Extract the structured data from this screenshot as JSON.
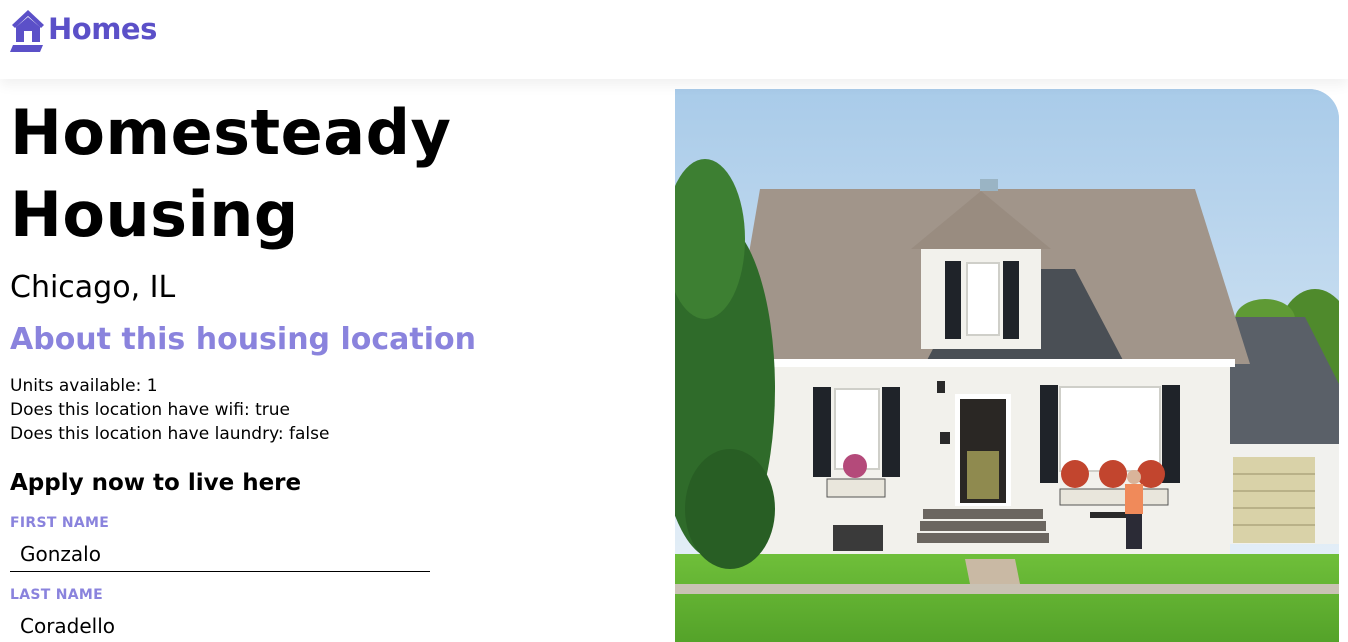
{
  "header": {
    "brand_text": "Homes",
    "brand_icon": "house-icon",
    "brand_color": "#5b50c8"
  },
  "listing": {
    "title": "Homesteady Housing",
    "location": "Chicago, IL",
    "about_heading": "About this housing location",
    "features": [
      "Units available: 1",
      "Does this location have wifi: true",
      "Does this location have laundry: false"
    ],
    "photo": "house-photo"
  },
  "apply_form": {
    "heading": "Apply now to live here",
    "first_name_label": "FIRST NAME",
    "first_name_value": "Gonzalo",
    "last_name_label": "LAST NAME",
    "last_name_value": "Coradello"
  },
  "colors": {
    "accent": "#8a83dd",
    "text": "#000000",
    "background": "#ffffff"
  }
}
